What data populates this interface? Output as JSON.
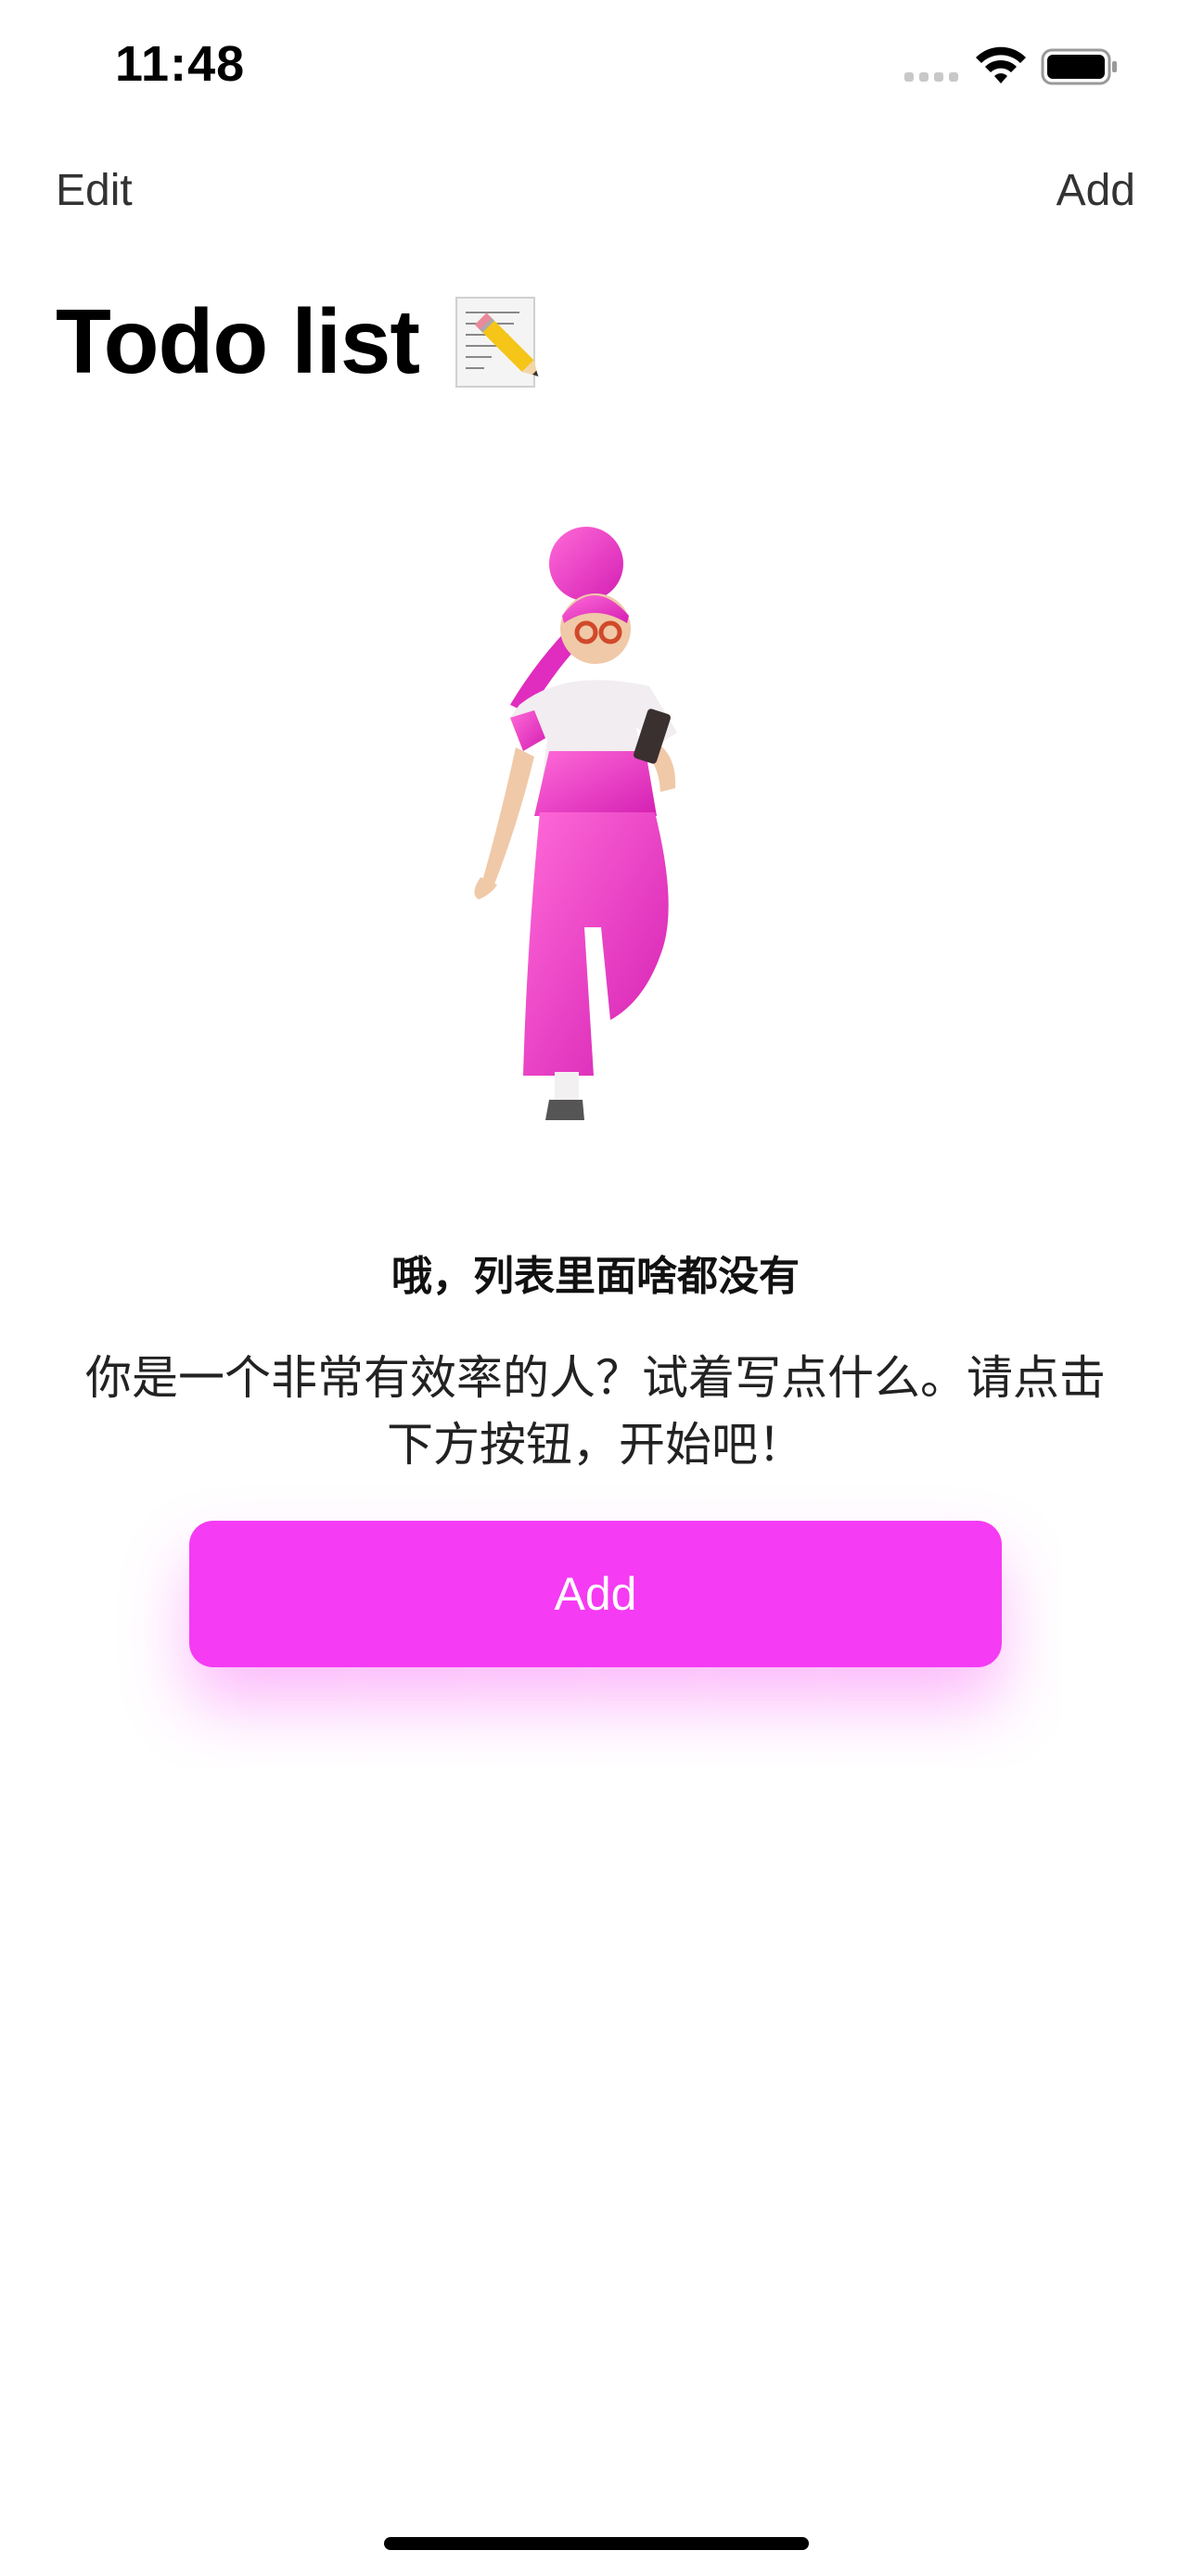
{
  "status_bar": {
    "time": "11:48",
    "signal_icon": "cellular-dots-icon",
    "wifi_icon": "wifi-icon",
    "battery_icon": "battery-icon"
  },
  "nav": {
    "left_label": "Edit",
    "right_label": "Add"
  },
  "title": {
    "text": "Todo list",
    "emoji_icon": "memo-pencil-icon"
  },
  "illustration": {
    "name": "pink-woman-with-phone-illustration"
  },
  "empty_state": {
    "heading": "哦，列表里面啥都没有",
    "body": "你是一个非常有效率的人？试着写点什么。请点击下方按钮，开始吧！",
    "button_label": "Add"
  },
  "colors": {
    "accent": "#f53bf3",
    "nav_text": "#333333",
    "background": "#ffffff"
  }
}
